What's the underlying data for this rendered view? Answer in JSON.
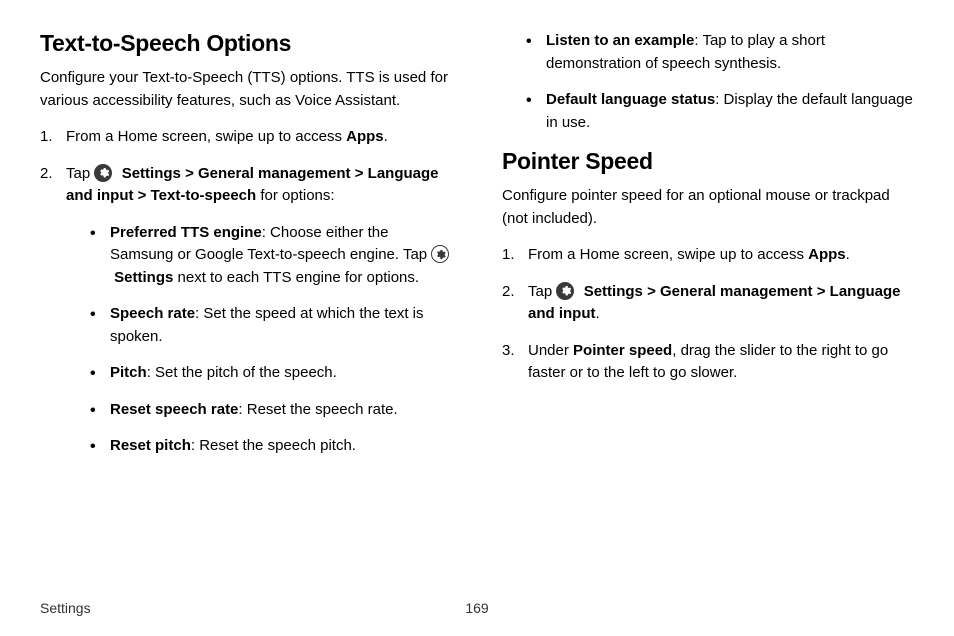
{
  "footer": {
    "label": "Settings",
    "page": "169"
  },
  "col1": {
    "heading": "Text-to-Speech Options",
    "intro": "Configure your Text-to-Speech (TTS) options. TTS is used for various accessibility features, such as Voice Assistant.",
    "step1_a": "From a Home screen, swipe up to access ",
    "step1_b": "Apps",
    "step1_c": ".",
    "step2_a": "Tap ",
    "step2_b": "Settings",
    "step2_c": "General management",
    "step2_d": "Language and input",
    "step2_e": "Text-to-speech",
    "step2_f": " for options:",
    "bullet1_a": "Preferred TTS engine",
    "bullet1_b": ": Choose either the Samsung or Google Text-to-speech engine. Tap ",
    "bullet1_c": "Settings",
    "bullet1_d": " next to each TTS engine for options.",
    "bullet2_a": "Speech rate",
    "bullet2_b": ": Set the speed at which the text is spoken.",
    "bullet3_a": "Pitch",
    "bullet3_b": ": Set the pitch of the speech.",
    "bullet4_a": "Reset speech rate",
    "bullet4_b": ": Reset the speech rate.",
    "bullet5_a": "Reset pitch",
    "bullet5_b": ": Reset the speech pitch."
  },
  "col2": {
    "top_bullet1_a": "Listen to an example",
    "top_bullet1_b": ": Tap to play a short demonstration of speech synthesis.",
    "top_bullet2_a": "Default language status",
    "top_bullet2_b": ": Display the default language in use.",
    "heading": "Pointer Speed",
    "intro": "Configure pointer speed for an optional mouse or trackpad (not included).",
    "step1_a": "From a Home screen, swipe up to access ",
    "step1_b": "Apps",
    "step1_c": ".",
    "step2_a": "Tap ",
    "step2_b": "Settings",
    "step2_c": "General management",
    "step2_d": "Language and input",
    "step2_e": ".",
    "step3_a": "Under ",
    "step3_b": "Pointer speed",
    "step3_c": ", drag the slider to the right to go faster or to the left to go slower."
  },
  "glyphs": {
    "chevron": ">"
  }
}
